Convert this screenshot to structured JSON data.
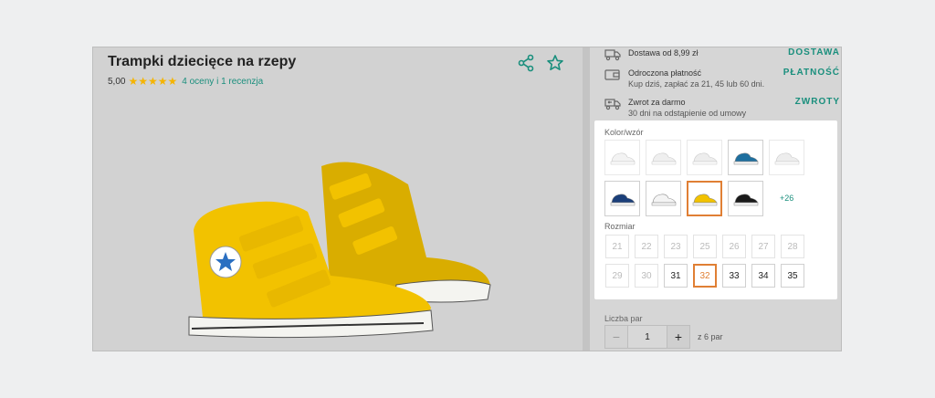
{
  "product": {
    "title": "Trampki dziecięce na rzepy",
    "rating_value": "5,00",
    "stars": "★★★★★",
    "rating_link": "4 oceny i 1 recenzja"
  },
  "header_icons": [
    "share-icon",
    "star-outline-icon"
  ],
  "info": [
    {
      "icon": "truck-icon",
      "title": "Dostawa od 8,99 zł",
      "sub": "",
      "link": "DOSTAWA"
    },
    {
      "icon": "wallet-icon",
      "title": "Odroczona płatność",
      "sub": "Kup dziś, zapłać za 21, 45 lub 60 dni.",
      "link": "PŁATNOŚĆ"
    },
    {
      "icon": "return-truck-icon",
      "title": "Zwrot za darmo",
      "sub": "30 dni na odstąpienie od umowy",
      "link": "ZWROTY"
    }
  ],
  "color": {
    "label": "Kolor/wzór",
    "more": "+26",
    "swatches": [
      {
        "color": "#e6e6e6",
        "faded": true
      },
      {
        "color": "#dcdcdc",
        "faded": true
      },
      {
        "color": "#d8d8d8",
        "faded": true
      },
      {
        "color": "#1e6f9f",
        "faded": false
      },
      {
        "color": "#d9d9d9",
        "faded": true
      },
      {
        "color": "#1b3f7a",
        "faded": false
      },
      {
        "color": "#f4f4f4",
        "faded": false
      },
      {
        "color": "#f2c200",
        "faded": false,
        "selected": true
      },
      {
        "color": "#1a1a1a",
        "faded": false
      }
    ]
  },
  "size": {
    "label": "Rozmiar",
    "values": [
      "21",
      "22",
      "23",
      "25",
      "26",
      "27",
      "28",
      "29",
      "30",
      "31",
      "32",
      "33",
      "34",
      "35"
    ],
    "disabled": [
      "21",
      "22",
      "23",
      "25",
      "26",
      "27",
      "28",
      "29",
      "30"
    ],
    "selected": "32"
  },
  "quantity": {
    "label": "Liczba par",
    "minus": "−",
    "value": "1",
    "plus": "+",
    "note": "z 6 par"
  },
  "colors": {
    "accent": "#1a8f7d",
    "selected": "#e07f34",
    "star": "#f5b400"
  }
}
